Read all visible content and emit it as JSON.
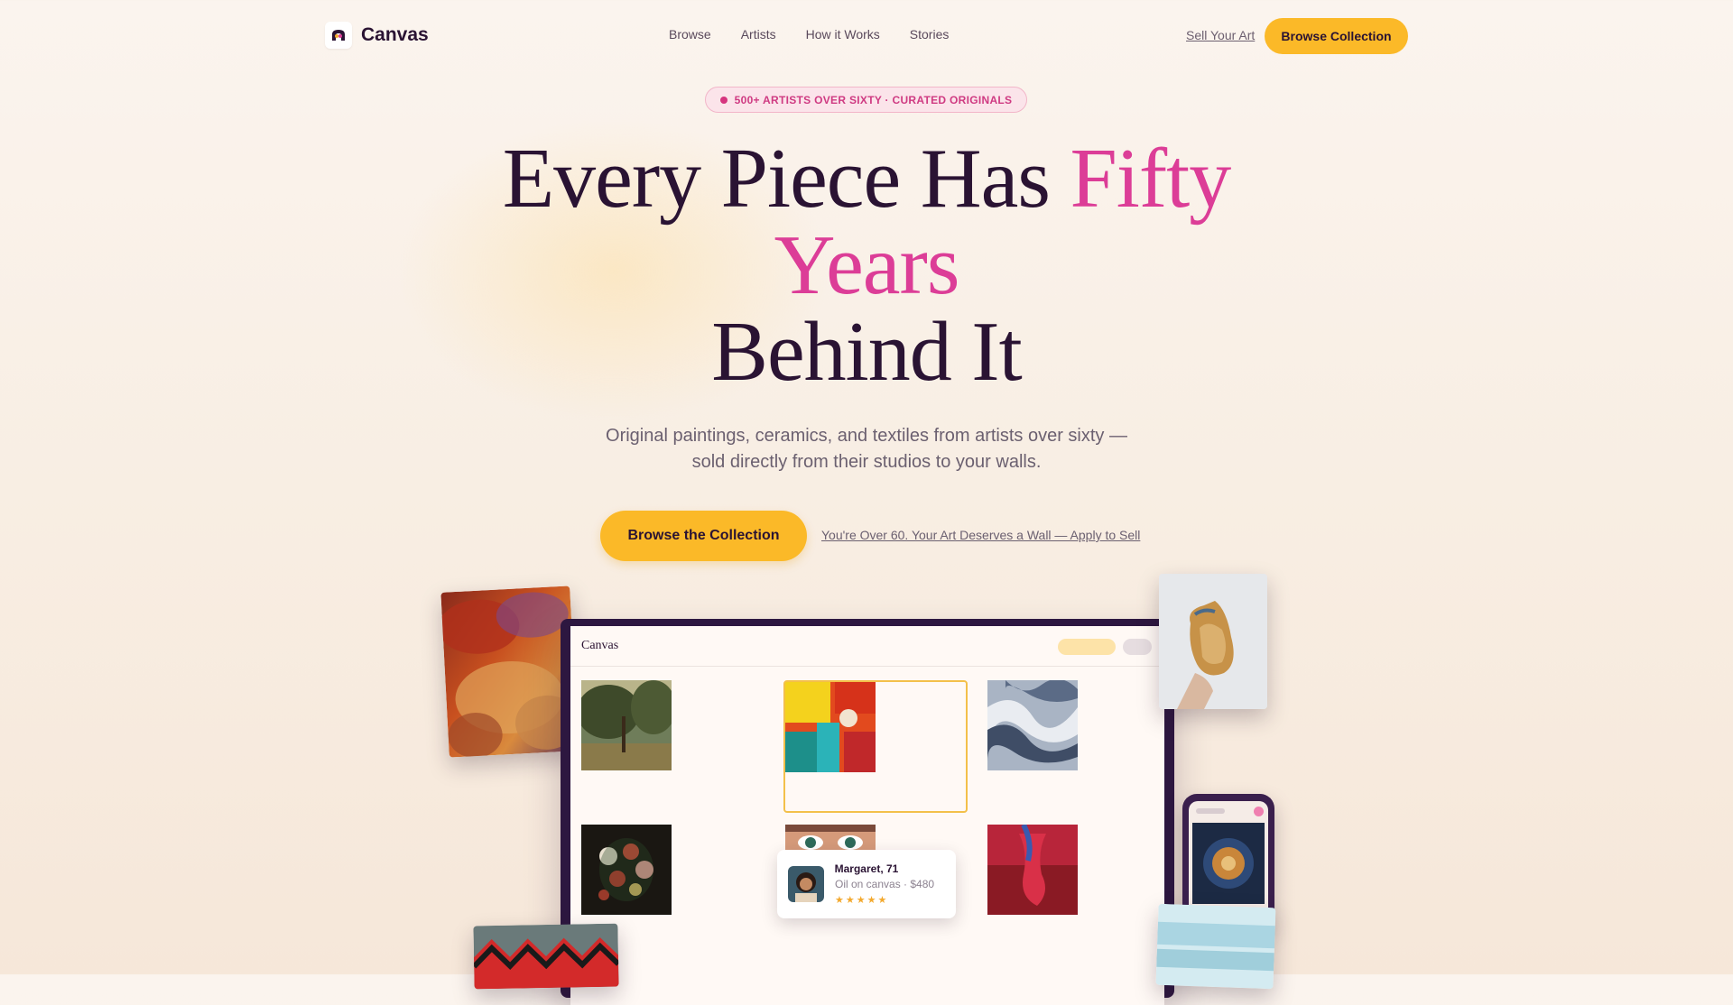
{
  "brand": {
    "name": "Canvas"
  },
  "nav": {
    "links": [
      "Browse",
      "Artists",
      "How it Works",
      "Stories"
    ],
    "sell_link": "Sell Your Art",
    "cta": "Browse Collection"
  },
  "hero": {
    "badge": "500+ ARTISTS OVER SIXTY · CURATED ORIGINALS",
    "headline_part1": "Every Piece Has ",
    "headline_accent": "Fifty Years",
    "headline_part2": "Behind It",
    "subhead": "Original paintings, ceramics, and textiles from artists over sixty — sold directly from their studios to your walls.",
    "primary_cta": "Browse the Collection",
    "secondary_cta": "You're Over 60. Your Art Deserves a Wall — Apply to Sell"
  },
  "mockup": {
    "title": "Canvas",
    "artworks": [
      "landscape-painting",
      "abstract-painting",
      "marble-swirl",
      "floral-still-life",
      "eyes-portrait",
      "red-hand"
    ]
  },
  "artist_card": {
    "name": "Margaret, 71",
    "meta": "Oil on canvas · $480",
    "stars": "★★★★★"
  },
  "colors": {
    "accent_yellow": "#fbb928",
    "accent_pink": "#dc3d97",
    "ink": "#2a1333"
  }
}
